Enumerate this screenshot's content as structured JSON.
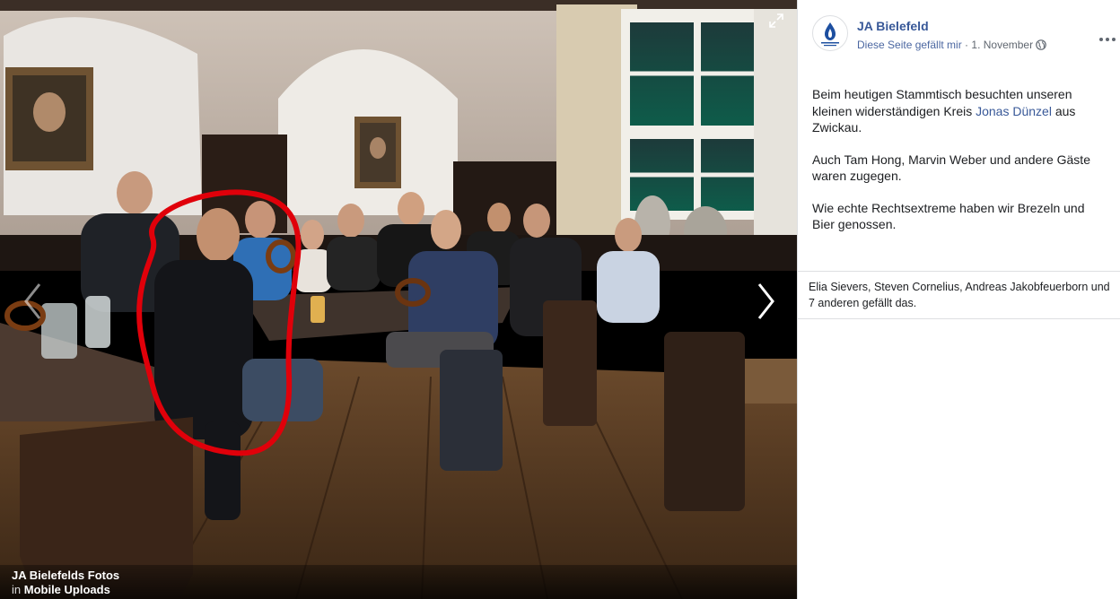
{
  "viewer": {
    "caption": {
      "album": "JA Bielefelds Fotos",
      "in_label": "in",
      "sub_album": "Mobile Uploads"
    },
    "icons": {
      "prev": "chevron-left-icon",
      "next": "chevron-right-icon",
      "expand": "expand-icon"
    }
  },
  "post": {
    "page_name": "JA Bielefeld",
    "avatar_text": "JUNGE ALTERNATIVE BIELEFELD",
    "like_text": "Diese Seite gefällt mir",
    "separator": " · ",
    "date": "1. November",
    "paragraph1_before": "Beim heutigen Stammtisch besuchten unseren kleinen widerständigen Kreis ",
    "mention": "Jonas Dünzel",
    "paragraph1_after": " aus Zwickau.",
    "paragraph2": "Auch Tam Hong, Marvin Weber und andere Gäste waren zugegen.",
    "paragraph3": "Wie echte Rechtsextreme haben wir Brezeln und Bier genossen.",
    "likes": "Elia Sievers, Steven Cornelius, Andreas Jakobfeuerborn und 7 anderen gefällt das."
  },
  "colors": {
    "link": "#385898",
    "annotation_ring": "#e0000a",
    "text": "#1c1e21",
    "meta": "#606770"
  }
}
